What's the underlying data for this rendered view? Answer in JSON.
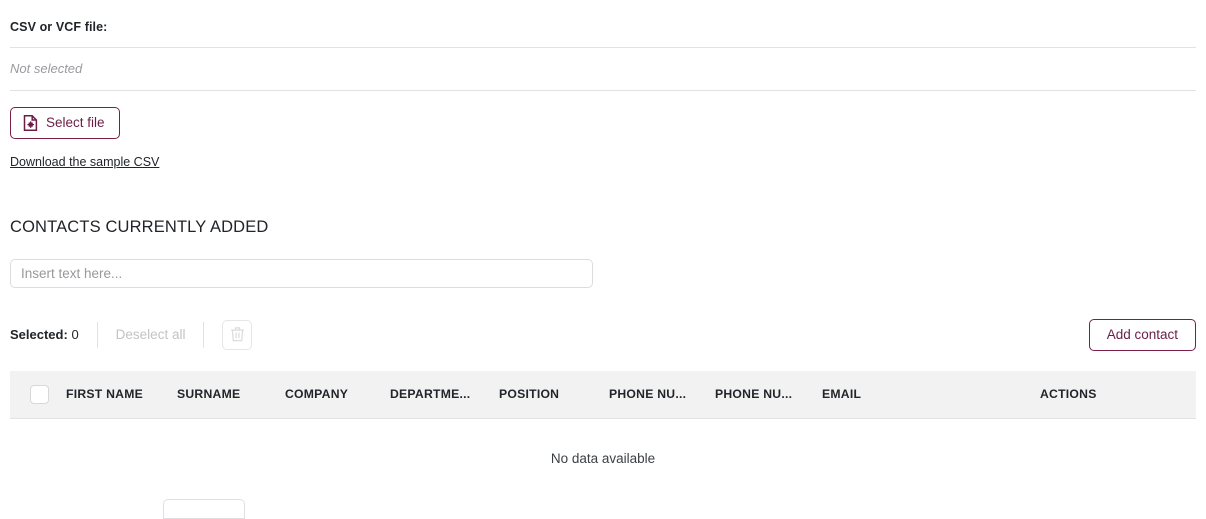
{
  "upload": {
    "label": "CSV or VCF file:",
    "status": "Not selected",
    "select_button": "Select file",
    "select_button_icon": "file-plus-icon",
    "sample_link": "Download the sample CSV"
  },
  "contacts": {
    "section_title": "CONTACTS CURRENTLY ADDED",
    "search_placeholder": "Insert text here...",
    "search_value": "",
    "toolbar": {
      "selected_label": "Selected:",
      "selected_count": "0",
      "deselect_all": "Deselect all",
      "delete_icon": "trash-icon",
      "add_contact": "Add contact"
    },
    "table": {
      "select_all_checkbox": "select-all-checkbox",
      "columns": [
        "FIRST NAME",
        "SURNAME",
        "COMPANY",
        "DEPARTME...",
        "POSITION",
        "PHONE NU...",
        "PHONE NU...",
        "EMAIL",
        "ACTIONS"
      ],
      "empty_message": "No data available",
      "rows": []
    }
  },
  "colors": {
    "accent": "#6b1e45",
    "accent_border": "#7a2048",
    "header_bg": "#f2f2f3",
    "divider": "#e2e2e4",
    "muted_text": "#98989d",
    "disabled_text": "#c3c3c7"
  }
}
